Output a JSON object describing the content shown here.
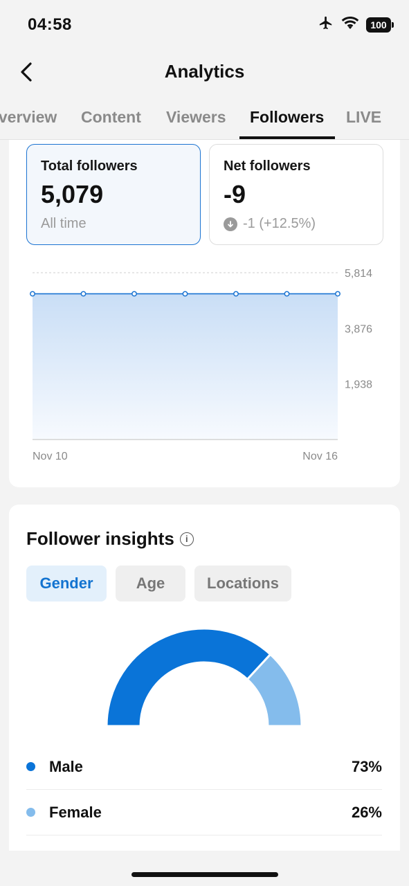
{
  "status_bar": {
    "time": "04:58",
    "battery": "100"
  },
  "header": {
    "title": "Analytics"
  },
  "tabs": [
    {
      "label": "Overview",
      "active": false
    },
    {
      "label": "Content",
      "active": false
    },
    {
      "label": "Viewers",
      "active": false
    },
    {
      "label": "Followers",
      "active": true
    },
    {
      "label": "LIVE",
      "active": false
    }
  ],
  "stats": {
    "total": {
      "label": "Total followers",
      "value": "5,079",
      "sub": "All time"
    },
    "net": {
      "label": "Net followers",
      "value": "-9",
      "sub": "-1 (+12.5%)"
    }
  },
  "chart_data": {
    "type": "area",
    "x_labels": [
      "Nov 10",
      "Nov 16"
    ],
    "x": [
      "Nov 10",
      "Nov 11",
      "Nov 12",
      "Nov 13",
      "Nov 14",
      "Nov 15",
      "Nov 16"
    ],
    "values": [
      5079,
      5079,
      5079,
      5079,
      5079,
      5079,
      5079
    ],
    "y_ticks": [
      "5,814",
      "3,876",
      "1,938"
    ],
    "ylim": [
      0,
      5814
    ],
    "grid": true,
    "color": "#1a73d1"
  },
  "insights": {
    "title": "Follower insights",
    "segments": [
      {
        "label": "Gender",
        "active": true
      },
      {
        "label": "Age",
        "active": false
      },
      {
        "label": "Locations",
        "active": false
      }
    ],
    "gender": [
      {
        "name": "Male",
        "percent": "73%",
        "value": 73,
        "color": "#0a74d8"
      },
      {
        "name": "Female",
        "percent": "26%",
        "value": 26,
        "color": "#84bcec"
      }
    ]
  }
}
